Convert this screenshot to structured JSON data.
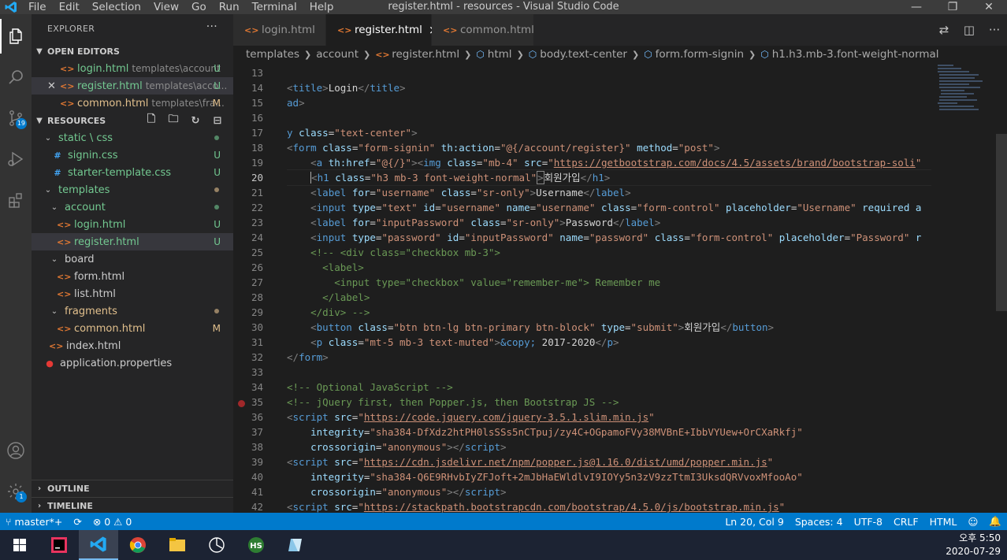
{
  "window": {
    "title": "register.html - resources - Visual Studio Code",
    "menu": [
      "File",
      "Edit",
      "Selection",
      "View",
      "Go",
      "Run",
      "Terminal",
      "Help"
    ]
  },
  "activity_bar": {
    "items": [
      "explorer-icon",
      "search-icon",
      "source-control-icon",
      "run-debug-icon",
      "extensions-icon"
    ],
    "scm_badge": "19",
    "bottom": [
      "account-icon",
      "settings-icon"
    ],
    "settings_badge": "1"
  },
  "sidebar": {
    "title": "EXPLORER",
    "more": "···",
    "open_editors": {
      "label": "OPEN EDITORS",
      "items": [
        {
          "name": "login.html",
          "desc": "templates\\account",
          "status": "U"
        },
        {
          "name": "register.html",
          "desc": "templates\\acco...",
          "status": "U"
        },
        {
          "name": "common.html",
          "desc": "templates\\fra...",
          "status": "M"
        }
      ]
    },
    "resources": {
      "label": "RESOURCES",
      "tree": [
        {
          "name": "static \\ css",
          "type": "folder"
        },
        {
          "name": "signin.css",
          "status": "U"
        },
        {
          "name": "starter-template.css",
          "status": "U"
        },
        {
          "name": "templates",
          "type": "folder"
        },
        {
          "name": "account",
          "type": "folder"
        },
        {
          "name": "login.html",
          "status": "U"
        },
        {
          "name": "register.html",
          "status": "U"
        },
        {
          "name": "board",
          "type": "folder"
        },
        {
          "name": "form.html"
        },
        {
          "name": "list.html"
        },
        {
          "name": "fragments",
          "type": "folder"
        },
        {
          "name": "common.html",
          "status": "M"
        },
        {
          "name": "index.html"
        },
        {
          "name": "application.properties"
        }
      ]
    },
    "outline": "OUTLINE",
    "timeline": "TIMELINE"
  },
  "tabs": [
    {
      "label": "login.html"
    },
    {
      "label": "register.html",
      "close": "×"
    },
    {
      "label": "common.html"
    }
  ],
  "breadcrumb": [
    "templates",
    "account",
    "register.html",
    "html",
    "body.text-center",
    "form.form-signin",
    "h1.h3.mb-3.font-weight-normal"
  ],
  "editor": {
    "line_numbers": [
      "13",
      "14",
      "15",
      "16",
      "17",
      "18",
      "19",
      "20",
      "21",
      "22",
      "23",
      "24",
      "25",
      "26",
      "27",
      "28",
      "29",
      "30",
      "31",
      "32",
      "33",
      "34",
      "35",
      "36",
      "37",
      "38",
      "39",
      "40",
      "41",
      "42"
    ],
    "current_line": "20"
  },
  "status": {
    "branch": "master*+",
    "sync": "⟳",
    "problems": "⊗ 0 ⚠ 0",
    "position": "Ln 20, Col 9",
    "spaces": "Spaces: 4",
    "encoding": "UTF-8",
    "eol": "CRLF",
    "language": "HTML"
  },
  "taskbar": {
    "time": "오후 5:50",
    "date": "2020-07-29"
  }
}
